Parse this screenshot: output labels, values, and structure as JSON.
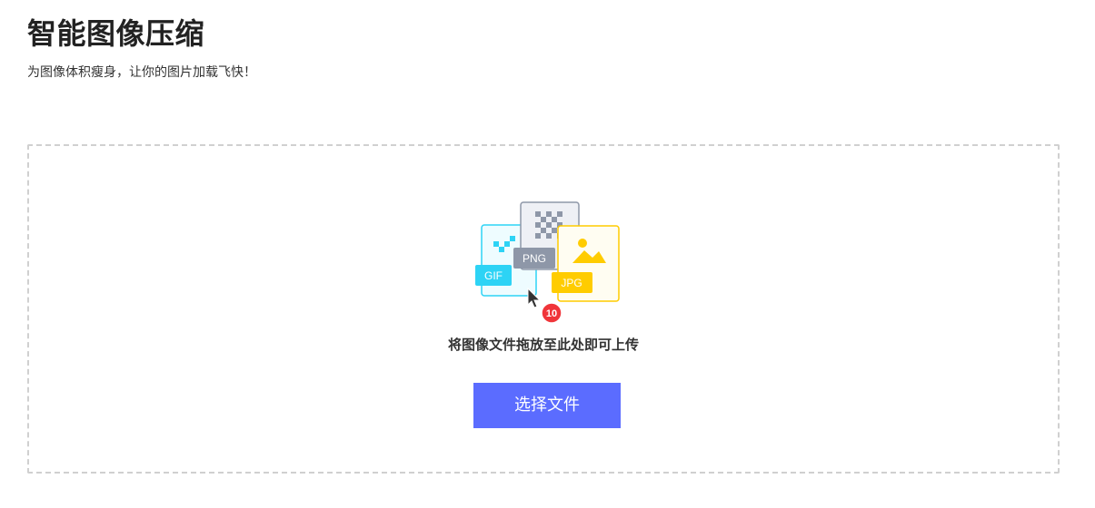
{
  "header": {
    "title": "智能图像压缩",
    "subtitle": "为图像体积瘦身，让你的图片加载飞快！"
  },
  "dropzone": {
    "hint": "将图像文件拖放至此处即可上传",
    "button_label": "选择文件",
    "file_types": [
      "GIF",
      "PNG",
      "JPG"
    ],
    "file_count_badge": "10"
  },
  "colors": {
    "button": "#5b6cff",
    "gif": "#2dd3f5",
    "png": "#8e97a8",
    "jpg": "#ffcc00",
    "badge": "#f0353a"
  }
}
